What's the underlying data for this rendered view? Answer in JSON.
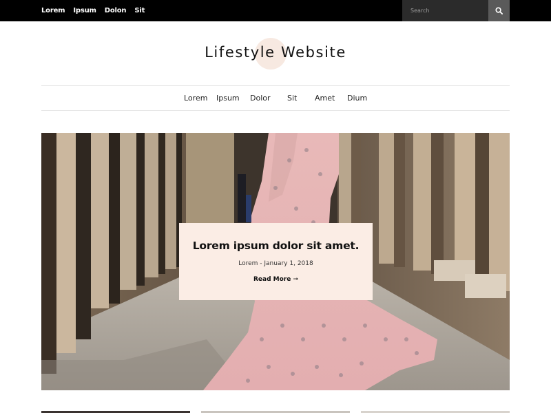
{
  "topbar": {
    "nav": [
      "Lorem",
      "Ipsum",
      "Dolon",
      "Sit"
    ],
    "search_placeholder": "Search",
    "search_icon": "search-icon"
  },
  "header": {
    "title": "Lifestyle Website"
  },
  "mainnav": {
    "items": [
      "Lorem",
      "Ipsum",
      "Dolor",
      "Sit",
      "Amet",
      "Dium"
    ]
  },
  "hero": {
    "title": "Lorem ipsum dolor sit amet.",
    "meta": "Lorem - January 1, 2018",
    "read_more": "Read More ➞"
  },
  "colors": {
    "topbar_bg": "#000000",
    "search_bg": "#2b2b2b",
    "search_btn_bg": "#5a5a5a",
    "accent_blush": "#fbede5",
    "logo_circle": "#f7e9e1"
  }
}
